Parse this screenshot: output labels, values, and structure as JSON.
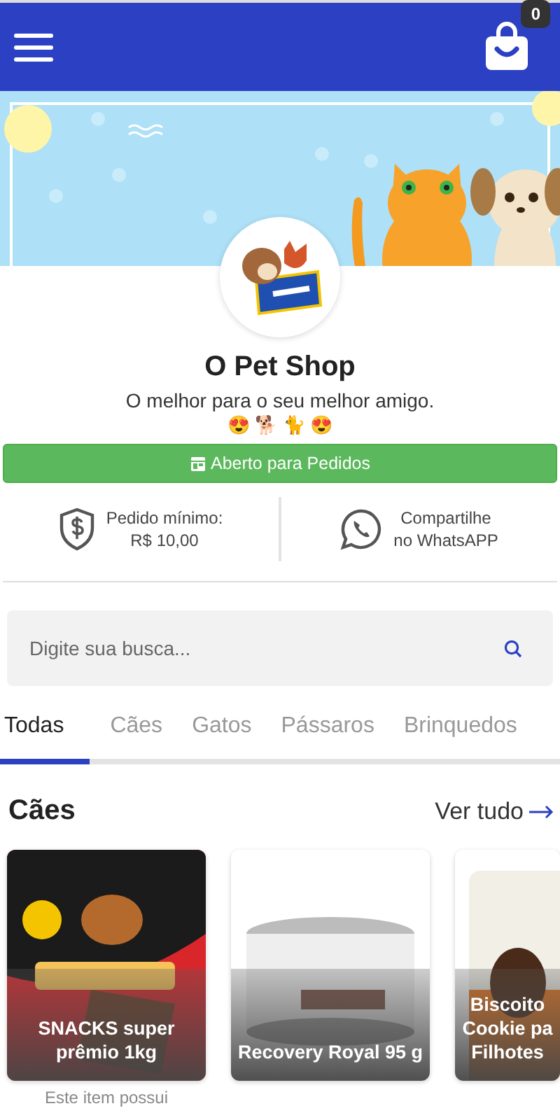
{
  "header": {
    "cart_count": "0"
  },
  "store": {
    "name": "O Pet Shop",
    "tagline": "O melhor para o seu melhor amigo.",
    "emojis": "😍 🐕 🐈 😍",
    "status_button": "Aberto para Pedidos"
  },
  "info": [
    {
      "kind": "min-order",
      "lines": [
        "Pedido mínimo:",
        "R$ 10,00"
      ]
    },
    {
      "kind": "whatsapp",
      "lines": [
        "Compartilhe",
        "no WhatsAPP"
      ]
    }
  ],
  "search": {
    "placeholder": "Digite sua busca..."
  },
  "tabs": [
    {
      "label": "Todas",
      "selected": true
    },
    {
      "label": "Cães",
      "selected": false
    },
    {
      "label": "Gatos",
      "selected": false
    },
    {
      "label": "Pássaros",
      "selected": false
    },
    {
      "label": "Brinquedos",
      "selected": false
    }
  ],
  "section": {
    "title": "Cães",
    "link": "Ver tudo"
  },
  "products": [
    {
      "kind": "snack-bag",
      "name": "SNACKS super prêmio 1kg",
      "note": "Este item possui"
    },
    {
      "kind": "can",
      "name": "Recovery Royal 95 g"
    },
    {
      "kind": "cookie-bag",
      "name": "Biscoito Cookie pa Filhotes"
    }
  ]
}
